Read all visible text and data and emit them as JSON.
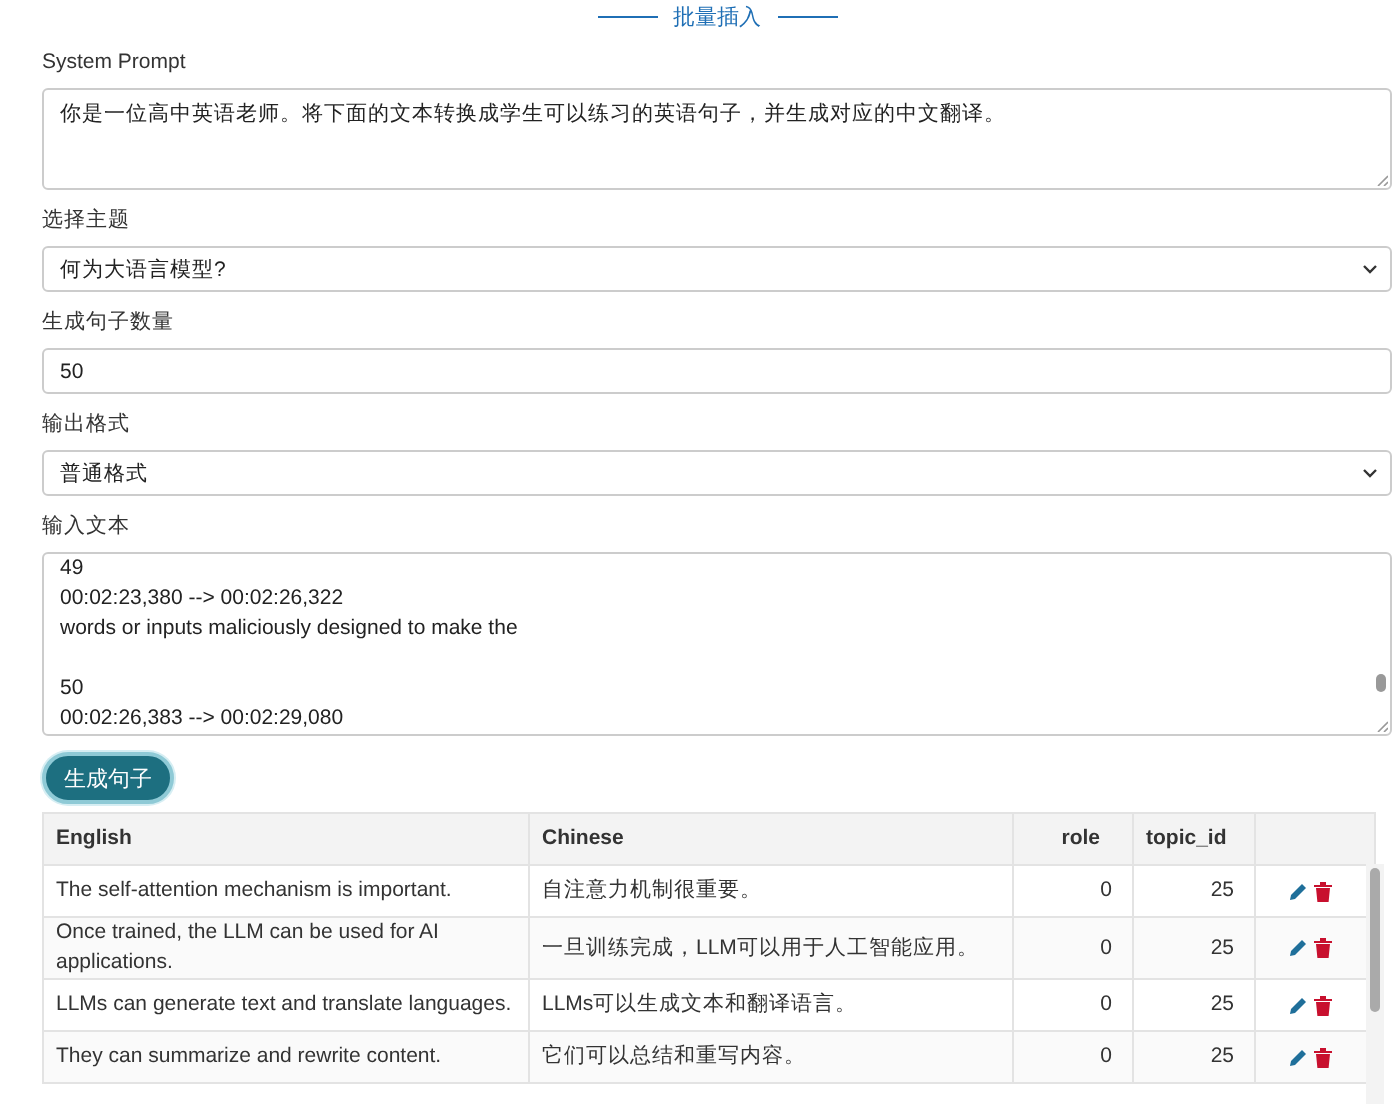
{
  "title": "批量插入",
  "fields": [
    {
      "kind": "textarea",
      "label": "System Prompt",
      "value": "你是一位高中英语老师。将下面的文本转换成学生可以练习的英语句子，并生成对应的中文翻译。"
    },
    {
      "kind": "select",
      "label": "选择主题",
      "value": "何为大语言模型?"
    },
    {
      "kind": "input",
      "label": "生成句子数量",
      "value": "50"
    },
    {
      "kind": "select",
      "label": "输出格式",
      "value": "普通格式"
    },
    {
      "kind": "textarea",
      "label": "输入文本",
      "value": "49\n00:02:23,380 --> 00:02:26,322\nwords or inputs maliciously designed to make the\n\n50\n00:02:26,383 --> 00:02:29,080"
    }
  ],
  "button": "生成句子",
  "table": {
    "columns": [
      "English",
      "Chinese",
      "role",
      "topic_id"
    ],
    "rows": [
      {
        "english": "The self-attention mechanism is important.",
        "chinese": "自注意力机制很重要。",
        "role": "0",
        "topic_id": "25"
      },
      {
        "english": "Once trained, the LLM can be used for AI applications.",
        "chinese": "一旦训练完成，LLM可以用于人工智能应用。",
        "role": "0",
        "topic_id": "25"
      },
      {
        "english": "LLMs can generate text and translate languages.",
        "chinese": "LLMs可以生成文本和翻译语言。",
        "role": "0",
        "topic_id": "25"
      },
      {
        "english": "They can summarize and rewrite content.",
        "chinese": "它们可以总结和重写内容。",
        "role": "0",
        "topic_id": "25"
      }
    ]
  }
}
